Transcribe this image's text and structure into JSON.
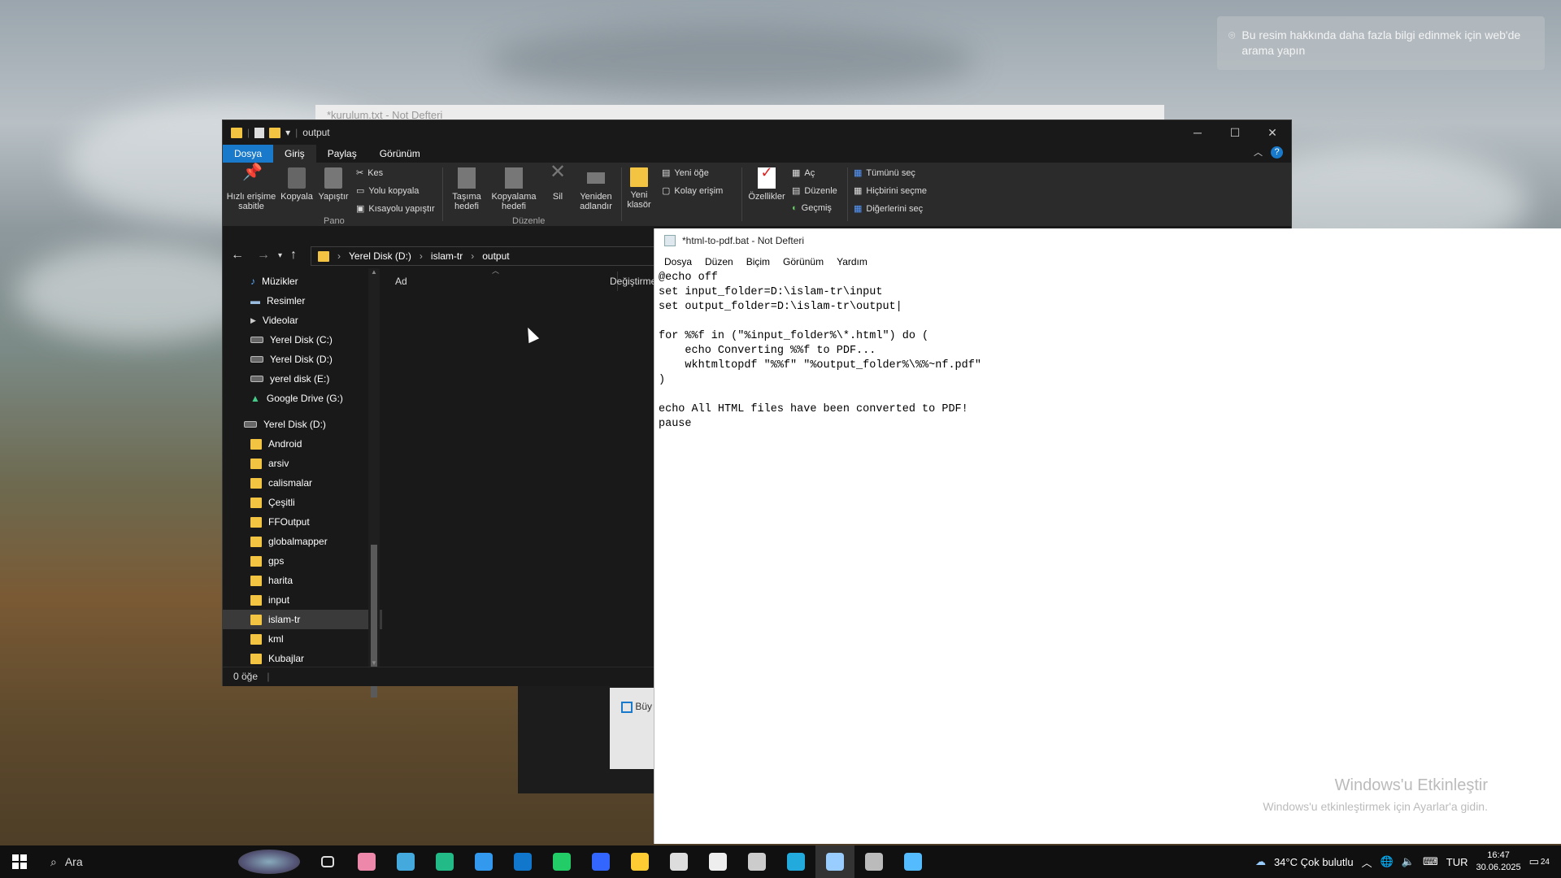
{
  "desktop": {
    "search_hint": "Bu resim hakkında daha fazla bilgi edinmek için web'de arama yapın",
    "activate_title": "Windows'u Etkinleştir",
    "activate_sub": "Windows'u etkinleştirmek için Ayarlar'a gidin."
  },
  "back_notepad": {
    "title": "*kurulum.txt - Not Defteri"
  },
  "explorer": {
    "title": "output",
    "tabs": [
      "Dosya",
      "Giriş",
      "Paylaş",
      "Görünüm"
    ],
    "ribbon": {
      "pin": "Hızlı erişime sabitle",
      "copy": "Kopyala",
      "paste": "Yapıştır",
      "cut": "Kes",
      "copy_path": "Yolu kopyala",
      "paste_shortcut": "Kısayolu yapıştır",
      "group_pano": "Pano",
      "move_to": "Taşıma hedefi",
      "copy_to": "Kopyalama hedefi",
      "delete": "Sil",
      "rename": "Yeniden adlandır",
      "group_duzenle": "Düzenle",
      "new_folder": "Yeni klasör",
      "new_item": "Yeni öğe",
      "easy_access": "Kolay erişim",
      "properties": "Özellikler",
      "open": "Aç",
      "edit": "Düzenle",
      "history": "Geçmiş",
      "select_all": "Tümünü seç",
      "select_none": "Hiçbirini seçme",
      "invert_select": "Diğerlerini seç"
    },
    "breadcrumb": [
      "Yerel Disk (D:)",
      "islam-tr",
      "output"
    ],
    "columns": {
      "name": "Ad",
      "modified": "Değiştirme"
    },
    "tree": [
      {
        "label": "Müzikler",
        "kind": "music"
      },
      {
        "label": "Resimler",
        "kind": "pictures"
      },
      {
        "label": "Videolar",
        "kind": "videos"
      },
      {
        "label": "Yerel Disk (C:)",
        "kind": "drive"
      },
      {
        "label": "Yerel Disk (D:)",
        "kind": "drive"
      },
      {
        "label": "yerel disk (E:)",
        "kind": "drive"
      },
      {
        "label": "Google Drive (G:)",
        "kind": "gdrive"
      },
      {
        "label": "Yerel Disk (D:)",
        "kind": "drive-root"
      },
      {
        "label": "Android",
        "kind": "folder"
      },
      {
        "label": "arsiv",
        "kind": "folder"
      },
      {
        "label": "calismalar",
        "kind": "folder"
      },
      {
        "label": "Çeşitli",
        "kind": "folder"
      },
      {
        "label": "FFOutput",
        "kind": "folder"
      },
      {
        "label": "globalmapper",
        "kind": "folder"
      },
      {
        "label": "gps",
        "kind": "folder"
      },
      {
        "label": "harita",
        "kind": "folder"
      },
      {
        "label": "input",
        "kind": "folder"
      },
      {
        "label": "islam-tr",
        "kind": "folder-selected"
      },
      {
        "label": "kml",
        "kind": "folder"
      },
      {
        "label": "Kubajlar",
        "kind": "folder"
      }
    ],
    "status": "0 öğe"
  },
  "notepad": {
    "title": "*html-to-pdf.bat - Not Defteri",
    "menu": [
      "Dosya",
      "Düzen",
      "Biçim",
      "Görünüm",
      "Yardım"
    ],
    "content": "@echo off\nset input_folder=D:\\islam-tr\\input\nset output_folder=D:\\islam-tr\\output|\n\nfor %%f in (\"%input_folder%\\*.html\") do (\n    echo Converting %%f to PDF...\n    wkhtmltopdf \"%%f\" \"%output_folder%\\%%~nf.pdf\"\n)\n\necho All HTML files have been converted to PDF!\npause"
  },
  "dialog": {
    "checkbox_label": "Büy"
  },
  "taskbar": {
    "search": "Ara",
    "weather": "34°C  Çok bulutlu",
    "lang": "TUR",
    "time": "16:47",
    "date": "30.06.2025",
    "notif_count": "24",
    "apps": [
      "task-view-icon",
      "copilot-icon",
      "app-icon",
      "edge-icon",
      "store-icon",
      "outlook-icon",
      "whatsapp-icon",
      "browser-icon",
      "explorer-icon",
      "app2-icon",
      "app3-icon",
      "settings-icon",
      "app4-icon",
      "notepad-icon",
      "app5-icon",
      "app6-icon"
    ]
  }
}
